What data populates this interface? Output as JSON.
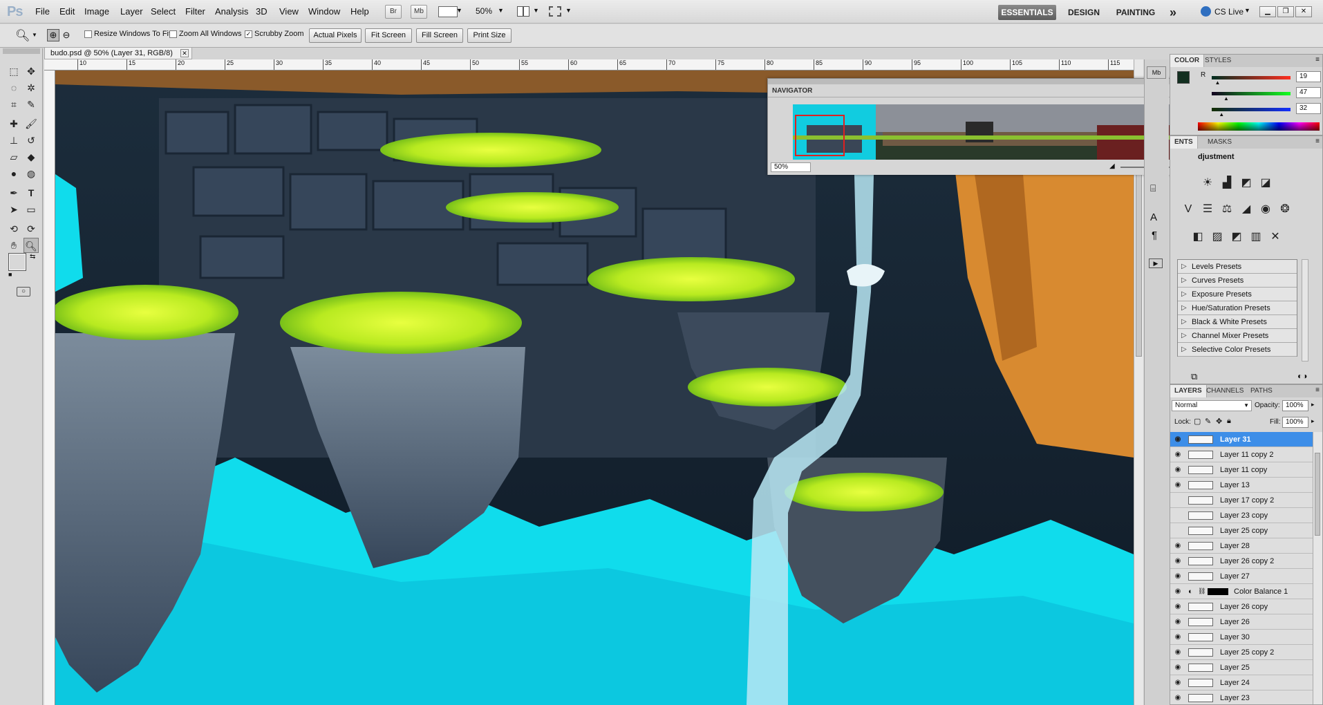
{
  "menubar": {
    "logo": "Ps",
    "menus": [
      "File",
      "Edit",
      "Image",
      "Layer",
      "Select",
      "Filter",
      "Analysis",
      "3D",
      "View",
      "Window",
      "Help"
    ],
    "bridge_label": "Br",
    "minibridge_label": "Mb",
    "zoom_label": "50%",
    "workspaces": [
      "ESSENTIALS",
      "DESIGN",
      "PAINTING"
    ],
    "more": "»",
    "cs_live": "CS Live"
  },
  "options": {
    "resize_windows": "Resize Windows To Fit",
    "zoom_all": "Zoom All Windows",
    "scrubby": "Scrubby Zoom",
    "actual_pixels": "Actual Pixels",
    "fit_screen": "Fit Screen",
    "fill_screen": "Fill Screen",
    "print_size": "Print Size"
  },
  "document": {
    "tab_title": "budo.psd @ 50% (Layer 31, RGB/8)",
    "ruler_ticks": [
      "10",
      "15",
      "20",
      "25",
      "30",
      "35",
      "40",
      "45",
      "50",
      "55",
      "60",
      "65",
      "70",
      "75",
      "80",
      "85",
      "90",
      "95",
      "100",
      "105",
      "110",
      "115"
    ]
  },
  "navigator": {
    "title": "NAVIGATOR",
    "zoom": "50%"
  },
  "color_panel": {
    "tabs": [
      "COLOR",
      "STYLES"
    ],
    "r_label": "R",
    "r": "19",
    "g": "47",
    "b": "32",
    "r_fraction": 0.075,
    "g_fraction": 0.184,
    "b_fraction": 0.125
  },
  "adjust_panel": {
    "tabs": [
      "ENTS",
      "MASKS"
    ],
    "title": "djustment",
    "presets": [
      "Levels Presets",
      "Curves Presets",
      "Exposure Presets",
      "Hue/Saturation Presets",
      "Black & White Presets",
      "Channel Mixer Presets",
      "Selective Color Presets"
    ]
  },
  "layers_panel": {
    "tabs": [
      "LAYERS",
      "CHANNELS",
      "PATHS"
    ],
    "blend_mode": "Normal",
    "opacity_label": "Opacity:",
    "opacity": "100%",
    "lock_label": "Lock:",
    "fill_label": "Fill:",
    "fill": "100%",
    "layers": [
      {
        "name": "Layer 31",
        "visible": true,
        "selected": true
      },
      {
        "name": "Layer 11 copy 2",
        "visible": true
      },
      {
        "name": "Layer 11 copy",
        "visible": true
      },
      {
        "name": "Layer 13",
        "visible": true
      },
      {
        "name": "Layer 17 copy 2",
        "visible": false
      },
      {
        "name": "Layer 23 copy",
        "visible": false
      },
      {
        "name": "Layer 25 copy",
        "visible": false
      },
      {
        "name": "Layer 28",
        "visible": true
      },
      {
        "name": "Layer 26 copy 2",
        "visible": true
      },
      {
        "name": "Layer 27",
        "visible": true
      },
      {
        "name": "Color Balance 1",
        "visible": true,
        "adjustment": true
      },
      {
        "name": "Layer 26 copy",
        "visible": true
      },
      {
        "name": "Layer 26",
        "visible": true
      },
      {
        "name": "Layer 30",
        "visible": true
      },
      {
        "name": "Layer 25 copy 2",
        "visible": true
      },
      {
        "name": "Layer 25",
        "visible": true
      },
      {
        "name": "Layer 24",
        "visible": true
      },
      {
        "name": "Layer 23",
        "visible": true
      }
    ]
  },
  "colors": {
    "selection": "#3d8ee8",
    "foreground": "#132f20",
    "background": "#0a0a0a",
    "cyan": "#10dcec",
    "grass": "#c8f028"
  }
}
